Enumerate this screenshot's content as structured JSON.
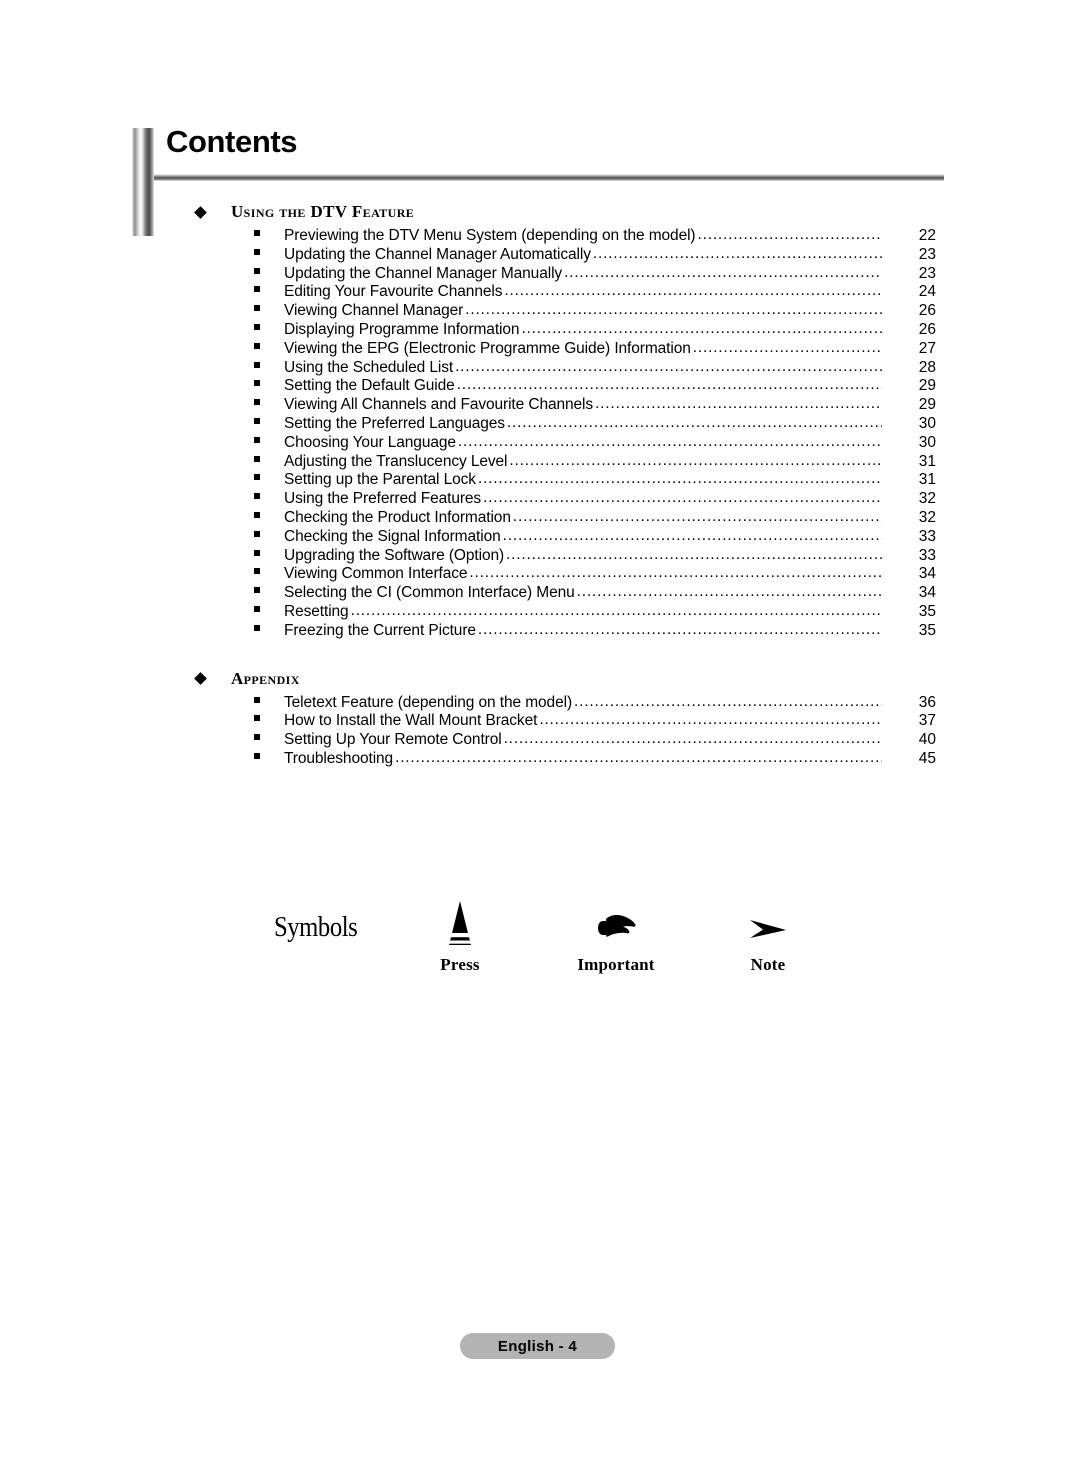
{
  "header": {
    "title": "Contents"
  },
  "sections": [
    {
      "name": "using-the-dtv-feature",
      "title": "Using the DTV Feature",
      "bullet_icon": "diamond-icon",
      "entries": [
        {
          "label": "Previewing the DTV Menu System (depending on the model)",
          "page": "22"
        },
        {
          "label": "Updating the Channel Manager Automatically",
          "page": "23"
        },
        {
          "label": "Updating the Channel Manager Manually",
          "page": "23"
        },
        {
          "label": "Editing Your Favourite Channels",
          "page": "24"
        },
        {
          "label": "Viewing Channel Manager",
          "page": "26"
        },
        {
          "label": "Displaying Programme Information",
          "page": "26"
        },
        {
          "label": "Viewing the EPG (Electronic Programme Guide) Information",
          "page": "27"
        },
        {
          "label": "Using the Scheduled List",
          "page": "28"
        },
        {
          "label": "Setting the Default Guide",
          "page": "29"
        },
        {
          "label": "Viewing All Channels and Favourite Channels",
          "page": "29"
        },
        {
          "label": "Setting the Preferred Languages",
          "page": "30"
        },
        {
          "label": "Choosing Your Language",
          "page": "30"
        },
        {
          "label": "Adjusting the Translucency Level",
          "page": "31"
        },
        {
          "label": "Setting up the Parental Lock",
          "page": "31"
        },
        {
          "label": "Using the Preferred Features",
          "page": "32"
        },
        {
          "label": "Checking the Product Information",
          "page": "32"
        },
        {
          "label": "Checking the Signal Information",
          "page": "33"
        },
        {
          "label": "Upgrading the Software (Option)",
          "page": "33"
        },
        {
          "label": "Viewing Common Interface",
          "page": "34"
        },
        {
          "label": "Selecting the CI (Common Interface) Menu",
          "page": "34"
        },
        {
          "label": "Resetting",
          "page": "35"
        },
        {
          "label": "Freezing the Current Picture",
          "page": "35"
        }
      ]
    },
    {
      "name": "appendix",
      "title": "Appendix",
      "bullet_icon": "diamond-icon",
      "entries": [
        {
          "label": "Teletext Feature (depending on the model)",
          "page": "36"
        },
        {
          "label": "How to Install the Wall Mount Bracket",
          "page": "37"
        },
        {
          "label": "Setting Up Your Remote Control",
          "page": "40"
        },
        {
          "label": "Troubleshooting",
          "page": "45"
        }
      ]
    }
  ],
  "symbols": {
    "heading": "Symbols",
    "items": [
      {
        "icon": "press-triangle-icon",
        "label": "Press"
      },
      {
        "icon": "pointing-hand-icon",
        "label": "Important"
      },
      {
        "icon": "arrowhead-icon",
        "label": "Note"
      }
    ]
  },
  "footer": {
    "page_label": "English - 4",
    "pill_color": "#b3b3b3"
  }
}
